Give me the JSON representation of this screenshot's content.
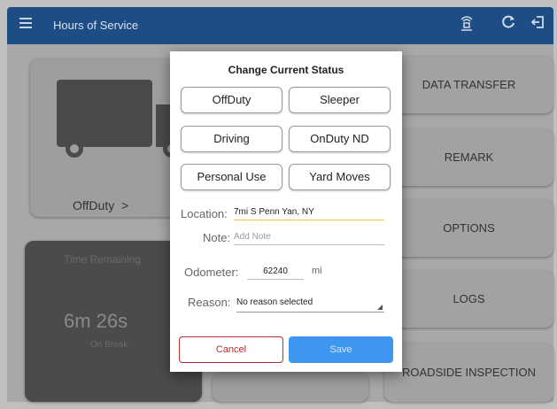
{
  "appbar": {
    "title": "Hours of Service"
  },
  "icons": {
    "menu": "menu-icon",
    "bluetooth": "eld-connection-icon",
    "refresh": "refresh-icon",
    "logout": "logout-icon"
  },
  "dashboard": {
    "status_label": "OffDuty",
    "status_arrow": ">",
    "timer_label": "Time Remaining",
    "timer_value": "6m 26s",
    "timer_sub": "On Break",
    "buttons": [
      "DATA TRANSFER",
      "REMARK",
      "OPTIONS",
      "LOGS",
      "ROADSIDE INSPECTION"
    ]
  },
  "dialog": {
    "title": "Change Current Status",
    "statuses": [
      "OffDuty",
      "Sleeper",
      "Driving",
      "OnDuty ND",
      "Personal Use",
      "Yard Moves"
    ],
    "location_label": "Location:",
    "location_value": "7mi S Penn Yan, NY",
    "note_label": "Note:",
    "note_placeholder": "Add Note",
    "odometer_label": "Odometer:",
    "odometer_value": "62240",
    "odometer_unit": "mi",
    "reason_label": "Reason:",
    "reason_value": "No reason selected",
    "cancel_label": "Cancel",
    "save_label": "Save"
  },
  "colors": {
    "appbar": "#1e4d86",
    "save": "#3d97f0",
    "cancel": "#b03030",
    "active_underline": "#e9c645"
  }
}
